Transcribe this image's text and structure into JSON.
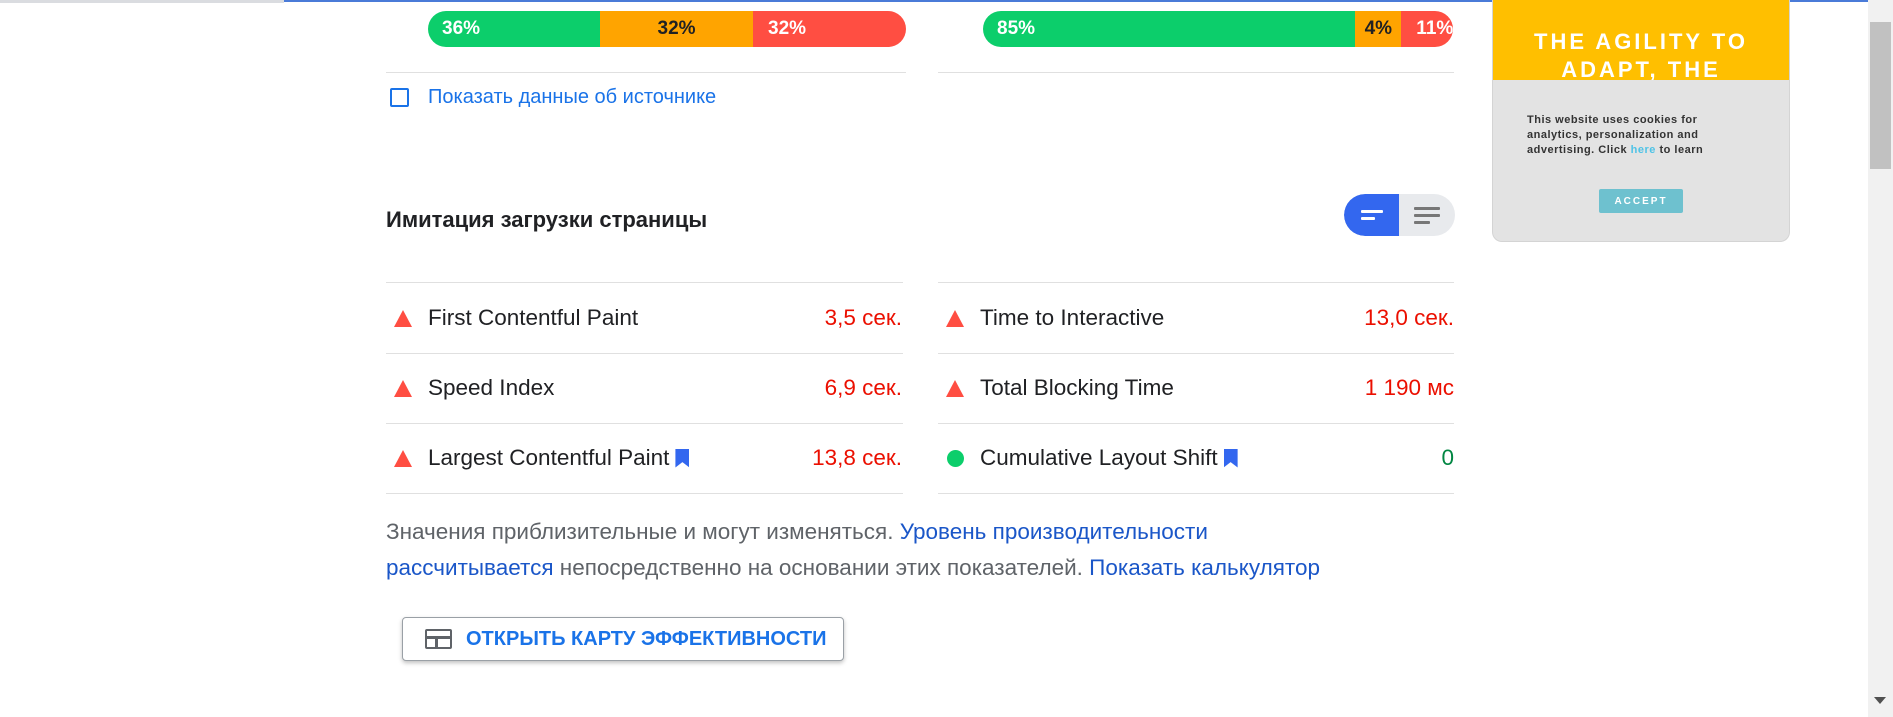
{
  "distribution_left": {
    "good": "36%",
    "average": "32%",
    "poor": "32%",
    "good_fraction": 0.36,
    "average_fraction": 0.32,
    "poor_fraction": 0.32
  },
  "distribution_right": {
    "good": "85%",
    "average": "4%",
    "poor": "11%",
    "good_fraction": 0.85,
    "average_fraction": 0.04,
    "poor_fraction": 0.11
  },
  "origin_toggle_label": "Показать данные об источнике",
  "lab": {
    "title": "Имитация загрузки страницы",
    "left_metrics": [
      {
        "name": "First Contentful Paint",
        "value": "3,5 сек.",
        "status": "poor"
      },
      {
        "name": "Speed Index",
        "value": "6,9 сек.",
        "status": "poor"
      },
      {
        "name": "Largest Contentful Paint",
        "value": "13,8 сек.",
        "status": "poor",
        "bookmarked": true
      }
    ],
    "right_metrics": [
      {
        "name": "Time to Interactive",
        "value": "13,0 сек.",
        "status": "poor"
      },
      {
        "name": "Total Blocking Time",
        "value": "1 190 мс",
        "status": "poor"
      },
      {
        "name": "Cumulative Layout Shift",
        "value": "0",
        "status": "good",
        "bookmarked": true
      }
    ]
  },
  "note": {
    "text1": "Значения приблизительные и могут изменяться.",
    "link1_line1": "Уровень производительности",
    "link1_line2": "рассчитывается",
    "text2": "непосредственно на основании этих показателей.",
    "link2": "Показать калькулятор"
  },
  "treemap_button": "ОТКРЫТЬ КАРТУ ЭФФЕКТИВНОСТИ",
  "ad": {
    "headline_line1": "THE AGILITY TO",
    "headline_line2": "ADAPT, THE",
    "text_line1": "This website uses cookies for",
    "text_line2": "analytics, personalization and",
    "text_line3_a": "advertising. Click",
    "text_link": "here",
    "text_line3_b": "to learn",
    "accept": "ACCEPT"
  },
  "colors": {
    "good": "#0cce6b",
    "average": "#ffa400",
    "poor": "#ff4e42",
    "link": "#1a73e8",
    "toggle_active": "#3367ef",
    "ad_header": "#ffbf00"
  },
  "icons": [
    "warning-triangle-icon",
    "pass-circle-icon",
    "bookmark-icon",
    "view-toggle-icon",
    "treemap-icon",
    "scroll-down-arrow-icon"
  ]
}
